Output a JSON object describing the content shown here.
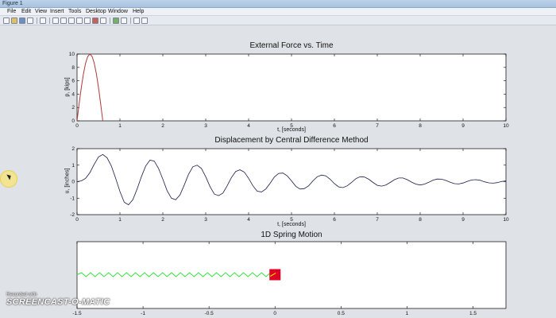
{
  "window": {
    "title": "Figure 1"
  },
  "menu": [
    "File",
    "Edit",
    "View",
    "Insert",
    "Tools",
    "Desktop",
    "Window",
    "Help"
  ],
  "colors": {
    "force_line": "#b03a3a",
    "displacement_line": "#1a1a4a",
    "spring": "#33e13a",
    "mass": "#e00024",
    "axis": "#000000"
  },
  "plots": {
    "force": {
      "title": "External Force vs. Time",
      "xlabel": "t, [seconds]",
      "ylabel": "p, [kips]"
    },
    "displacement": {
      "title": "Displacement by Central Difference Method",
      "xlabel": "t, [seconds]",
      "ylabel": "u, [inches]"
    },
    "spring": {
      "title": "1D Spring Motion"
    }
  },
  "chart_data": [
    {
      "type": "line",
      "title": "External Force vs. Time",
      "xlabel": "t, [seconds]",
      "ylabel": "p, [kips]",
      "xlim": [
        0,
        10
      ],
      "ylim": [
        0,
        10
      ],
      "xticks": [
        0,
        1,
        2,
        3,
        4,
        5,
        6,
        7,
        8,
        9,
        10
      ],
      "yticks": [
        0,
        2,
        4,
        6,
        8,
        10
      ],
      "grid": false,
      "x": [
        0,
        0.05,
        0.1,
        0.15,
        0.2,
        0.25,
        0.3,
        0.35,
        0.4,
        0.45,
        0.5,
        0.55,
        0.6
      ],
      "y": [
        0,
        2.59,
        5.0,
        7.07,
        8.66,
        9.66,
        10.0,
        9.66,
        8.66,
        7.07,
        5.0,
        2.59,
        0
      ]
    },
    {
      "type": "line",
      "title": "Displacement by Central Difference Method",
      "xlabel": "t, [seconds]",
      "ylabel": "u, [inches]",
      "xlim": [
        0,
        10
      ],
      "ylim": [
        -2,
        2
      ],
      "xticks": [
        0,
        1,
        2,
        3,
        4,
        5,
        6,
        7,
        8,
        9,
        10
      ],
      "yticks": [
        -2,
        -1,
        0,
        1,
        2
      ],
      "grid": false,
      "x": [
        0,
        0.1,
        0.2,
        0.3,
        0.4,
        0.5,
        0.6,
        0.7,
        0.8,
        0.9,
        1.0,
        1.1,
        1.2,
        1.3,
        1.4,
        1.5,
        1.6,
        1.7,
        1.8,
        1.9,
        2.0,
        2.1,
        2.2,
        2.3,
        2.4,
        2.5,
        2.6,
        2.7,
        2.8,
        2.9,
        3.0,
        3.1,
        3.2,
        3.3,
        3.4,
        3.5,
        3.6,
        3.7,
        3.8,
        3.9,
        4.0,
        4.1,
        4.2,
        4.3,
        4.4,
        4.5,
        4.6,
        4.7,
        4.8,
        4.9,
        5.0,
        5.1,
        5.2,
        5.3,
        5.4,
        5.5,
        5.6,
        5.7,
        5.8,
        5.9,
        6.0,
        6.1,
        6.2,
        6.3,
        6.4,
        6.5,
        6.6,
        6.7,
        6.8,
        6.9,
        7.0,
        7.1,
        7.2,
        7.3,
        7.4,
        7.5,
        7.6,
        7.7,
        7.8,
        7.9,
        8.0,
        8.1,
        8.2,
        8.3,
        8.4,
        8.5,
        8.6,
        8.7,
        8.8,
        8.9,
        9.0,
        9.1,
        9.2,
        9.3,
        9.4,
        9.5,
        9.6,
        9.7,
        9.8,
        9.9,
        10.0
      ],
      "y": [
        0,
        0.05,
        0.2,
        0.55,
        1.05,
        1.5,
        1.65,
        1.45,
        0.95,
        0.2,
        -0.6,
        -1.25,
        -1.4,
        -1.1,
        -0.45,
        0.3,
        0.95,
        1.3,
        1.25,
        0.8,
        0.15,
        -0.55,
        -1.0,
        -1.1,
        -0.8,
        -0.2,
        0.45,
        0.9,
        1.0,
        0.8,
        0.3,
        -0.3,
        -0.75,
        -0.85,
        -0.7,
        -0.25,
        0.25,
        0.62,
        0.72,
        0.58,
        0.2,
        -0.25,
        -0.58,
        -0.62,
        -0.45,
        -0.1,
        0.28,
        0.5,
        0.52,
        0.35,
        0.05,
        -0.28,
        -0.45,
        -0.42,
        -0.25,
        0.05,
        0.3,
        0.4,
        0.35,
        0.15,
        -0.12,
        -0.32,
        -0.36,
        -0.25,
        -0.05,
        0.18,
        0.3,
        0.28,
        0.15,
        -0.05,
        -0.22,
        -0.27,
        -0.2,
        -0.05,
        0.12,
        0.22,
        0.22,
        0.12,
        -0.03,
        -0.15,
        -0.2,
        -0.15,
        -0.04,
        0.09,
        0.16,
        0.15,
        0.07,
        -0.04,
        -0.12,
        -0.14,
        -0.08,
        0.02,
        0.1,
        0.12,
        0.08,
        -0.01,
        -0.07,
        -0.09,
        -0.06,
        0.01,
        0.05
      ]
    },
    {
      "type": "line",
      "title": "1D Spring Motion",
      "xlabel": "",
      "ylabel": "",
      "xlim": [
        -1.5,
        1.75
      ],
      "ylim": [
        -1,
        1
      ],
      "xticks": [
        -1.5,
        -1,
        -0.5,
        0,
        0.5,
        1,
        1.5
      ],
      "grid": false,
      "spring_coils": 22,
      "spring_from_x": -1.5,
      "mass_x": 0
    }
  ],
  "watermark": {
    "line1": "Recorded with",
    "line2": "SCREENCAST-O-MATIC"
  }
}
